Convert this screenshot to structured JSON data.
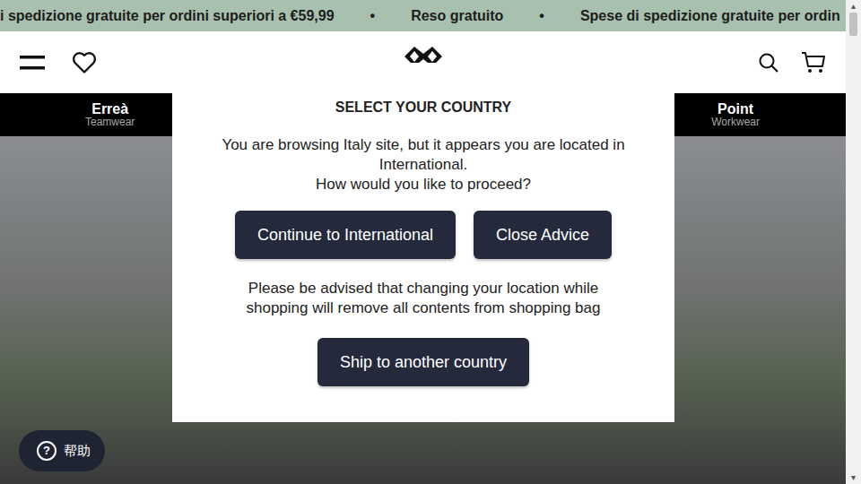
{
  "announcement_bar": {
    "items": [
      "i spedizione gratuite per ordini superiori a €59,99",
      "•",
      "Reso gratuito",
      "•",
      "Spese di spedizione gratuite per ordin"
    ]
  },
  "nav": [
    {
      "title": "Erreà",
      "subtitle": "Teamwear"
    },
    {
      "title": "Point",
      "subtitle": "Workwear"
    }
  ],
  "modal": {
    "title": "SELECT YOUR COUNTRY",
    "message": [
      "You are browsing Italy site, but it appears you are located in International.",
      "How would you like to proceed?"
    ],
    "buttons": [
      "Continue to International",
      "Close Advice"
    ],
    "note": "Please be advised that changing your location while shopping will remove all contents from shopping bag",
    "secondary_button": "Ship to another country"
  },
  "help": {
    "icon": "?",
    "label": "帮助"
  }
}
